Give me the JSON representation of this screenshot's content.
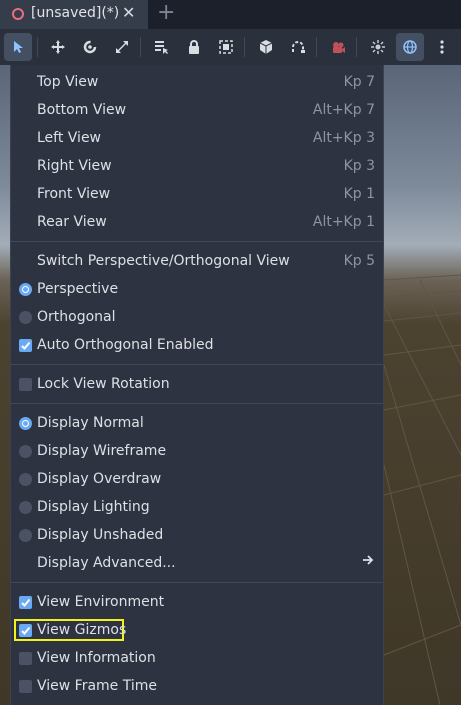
{
  "tab": {
    "title": "[unsaved](*)",
    "close_glyph": "✕",
    "add_glyph": "+"
  },
  "toolbar": {
    "buttons": [
      {
        "icon": "select-arrow-icon",
        "active": true
      },
      {
        "icon": "move-icon"
      },
      {
        "icon": "rotate-icon"
      },
      {
        "icon": "scale-icon"
      },
      {
        "icon": "list-select-icon"
      },
      {
        "icon": "lock-icon"
      },
      {
        "icon": "group-icon"
      },
      {
        "icon": "local-space-icon"
      },
      {
        "icon": "snap-icon"
      },
      {
        "icon": "camera-icon"
      },
      {
        "icon": "sun-icon"
      },
      {
        "icon": "globe-icon",
        "active": true
      },
      {
        "icon": "more-vertical-icon"
      }
    ]
  },
  "menu": {
    "top_view": {
      "label": "Top View",
      "shortcut": "Kp 7"
    },
    "bottom_view": {
      "label": "Bottom View",
      "shortcut": "Alt+Kp 7"
    },
    "left_view": {
      "label": "Left View",
      "shortcut": "Alt+Kp 3"
    },
    "right_view": {
      "label": "Right View",
      "shortcut": "Kp 3"
    },
    "front_view": {
      "label": "Front View",
      "shortcut": "Kp 1"
    },
    "rear_view": {
      "label": "Rear View",
      "shortcut": "Alt+Kp 1"
    },
    "switch_persp": {
      "label": "Switch Perspective/Orthogonal View",
      "shortcut": "Kp 5"
    },
    "perspective": {
      "label": "Perspective",
      "selected": true
    },
    "orthogonal": {
      "label": "Orthogonal",
      "selected": false
    },
    "auto_ortho": {
      "label": "Auto Orthogonal Enabled",
      "checked": true
    },
    "lock_rotation": {
      "label": "Lock View Rotation",
      "checked": false
    },
    "display_normal": {
      "label": "Display Normal",
      "selected": true
    },
    "display_wireframe": {
      "label": "Display Wireframe",
      "selected": false
    },
    "display_overdraw": {
      "label": "Display Overdraw",
      "selected": false
    },
    "display_lighting": {
      "label": "Display Lighting",
      "selected": false
    },
    "display_unshaded": {
      "label": "Display Unshaded",
      "selected": false
    },
    "display_advanced": {
      "label": "Display Advanced...",
      "arrow": "🡒"
    },
    "view_environment": {
      "label": "View Environment",
      "checked": true
    },
    "view_gizmos": {
      "label": "View Gizmos",
      "checked": true
    },
    "view_information": {
      "label": "View Information",
      "checked": false
    },
    "view_frame_time": {
      "label": "View Frame Time",
      "checked": false
    }
  },
  "colors": {
    "accent": "#6aa9f4",
    "highlight": "#f2f21a",
    "menu_bg": "#2d3340",
    "tab_marker": "#e8707e"
  }
}
